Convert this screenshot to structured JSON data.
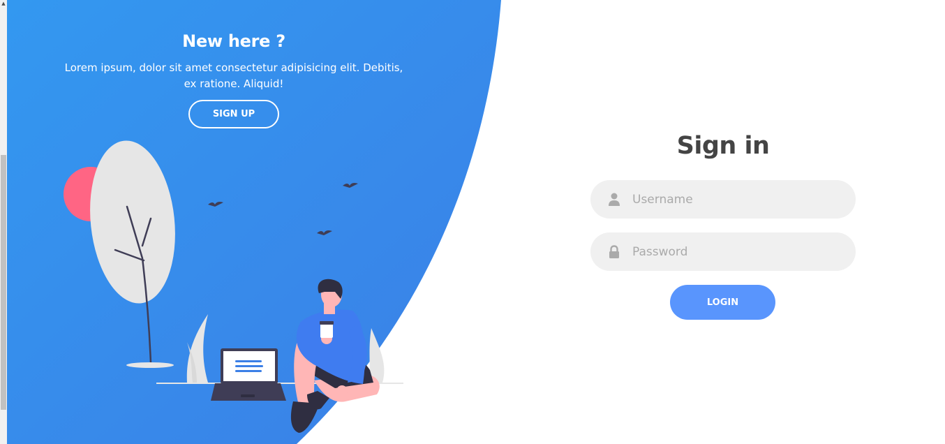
{
  "left_panel": {
    "heading": "New here ?",
    "description": "Lorem ipsum, dolor sit amet consectetur adipisicing elit. Debitis, ex ratione. Aliquid!",
    "signup_button": "SIGN UP"
  },
  "signin_form": {
    "title": "Sign in",
    "username_placeholder": "Username",
    "password_placeholder": "Password",
    "login_button": "LOGIN"
  },
  "icons": {
    "username": "user-icon",
    "password": "lock-icon"
  },
  "colors": {
    "panel_gradient_start": "#3398f0",
    "panel_gradient_end": "#3b7fe6",
    "primary": "#5995fd",
    "input_bg": "#f0f0f0",
    "title": "#444444",
    "sun": "#ff6584"
  }
}
